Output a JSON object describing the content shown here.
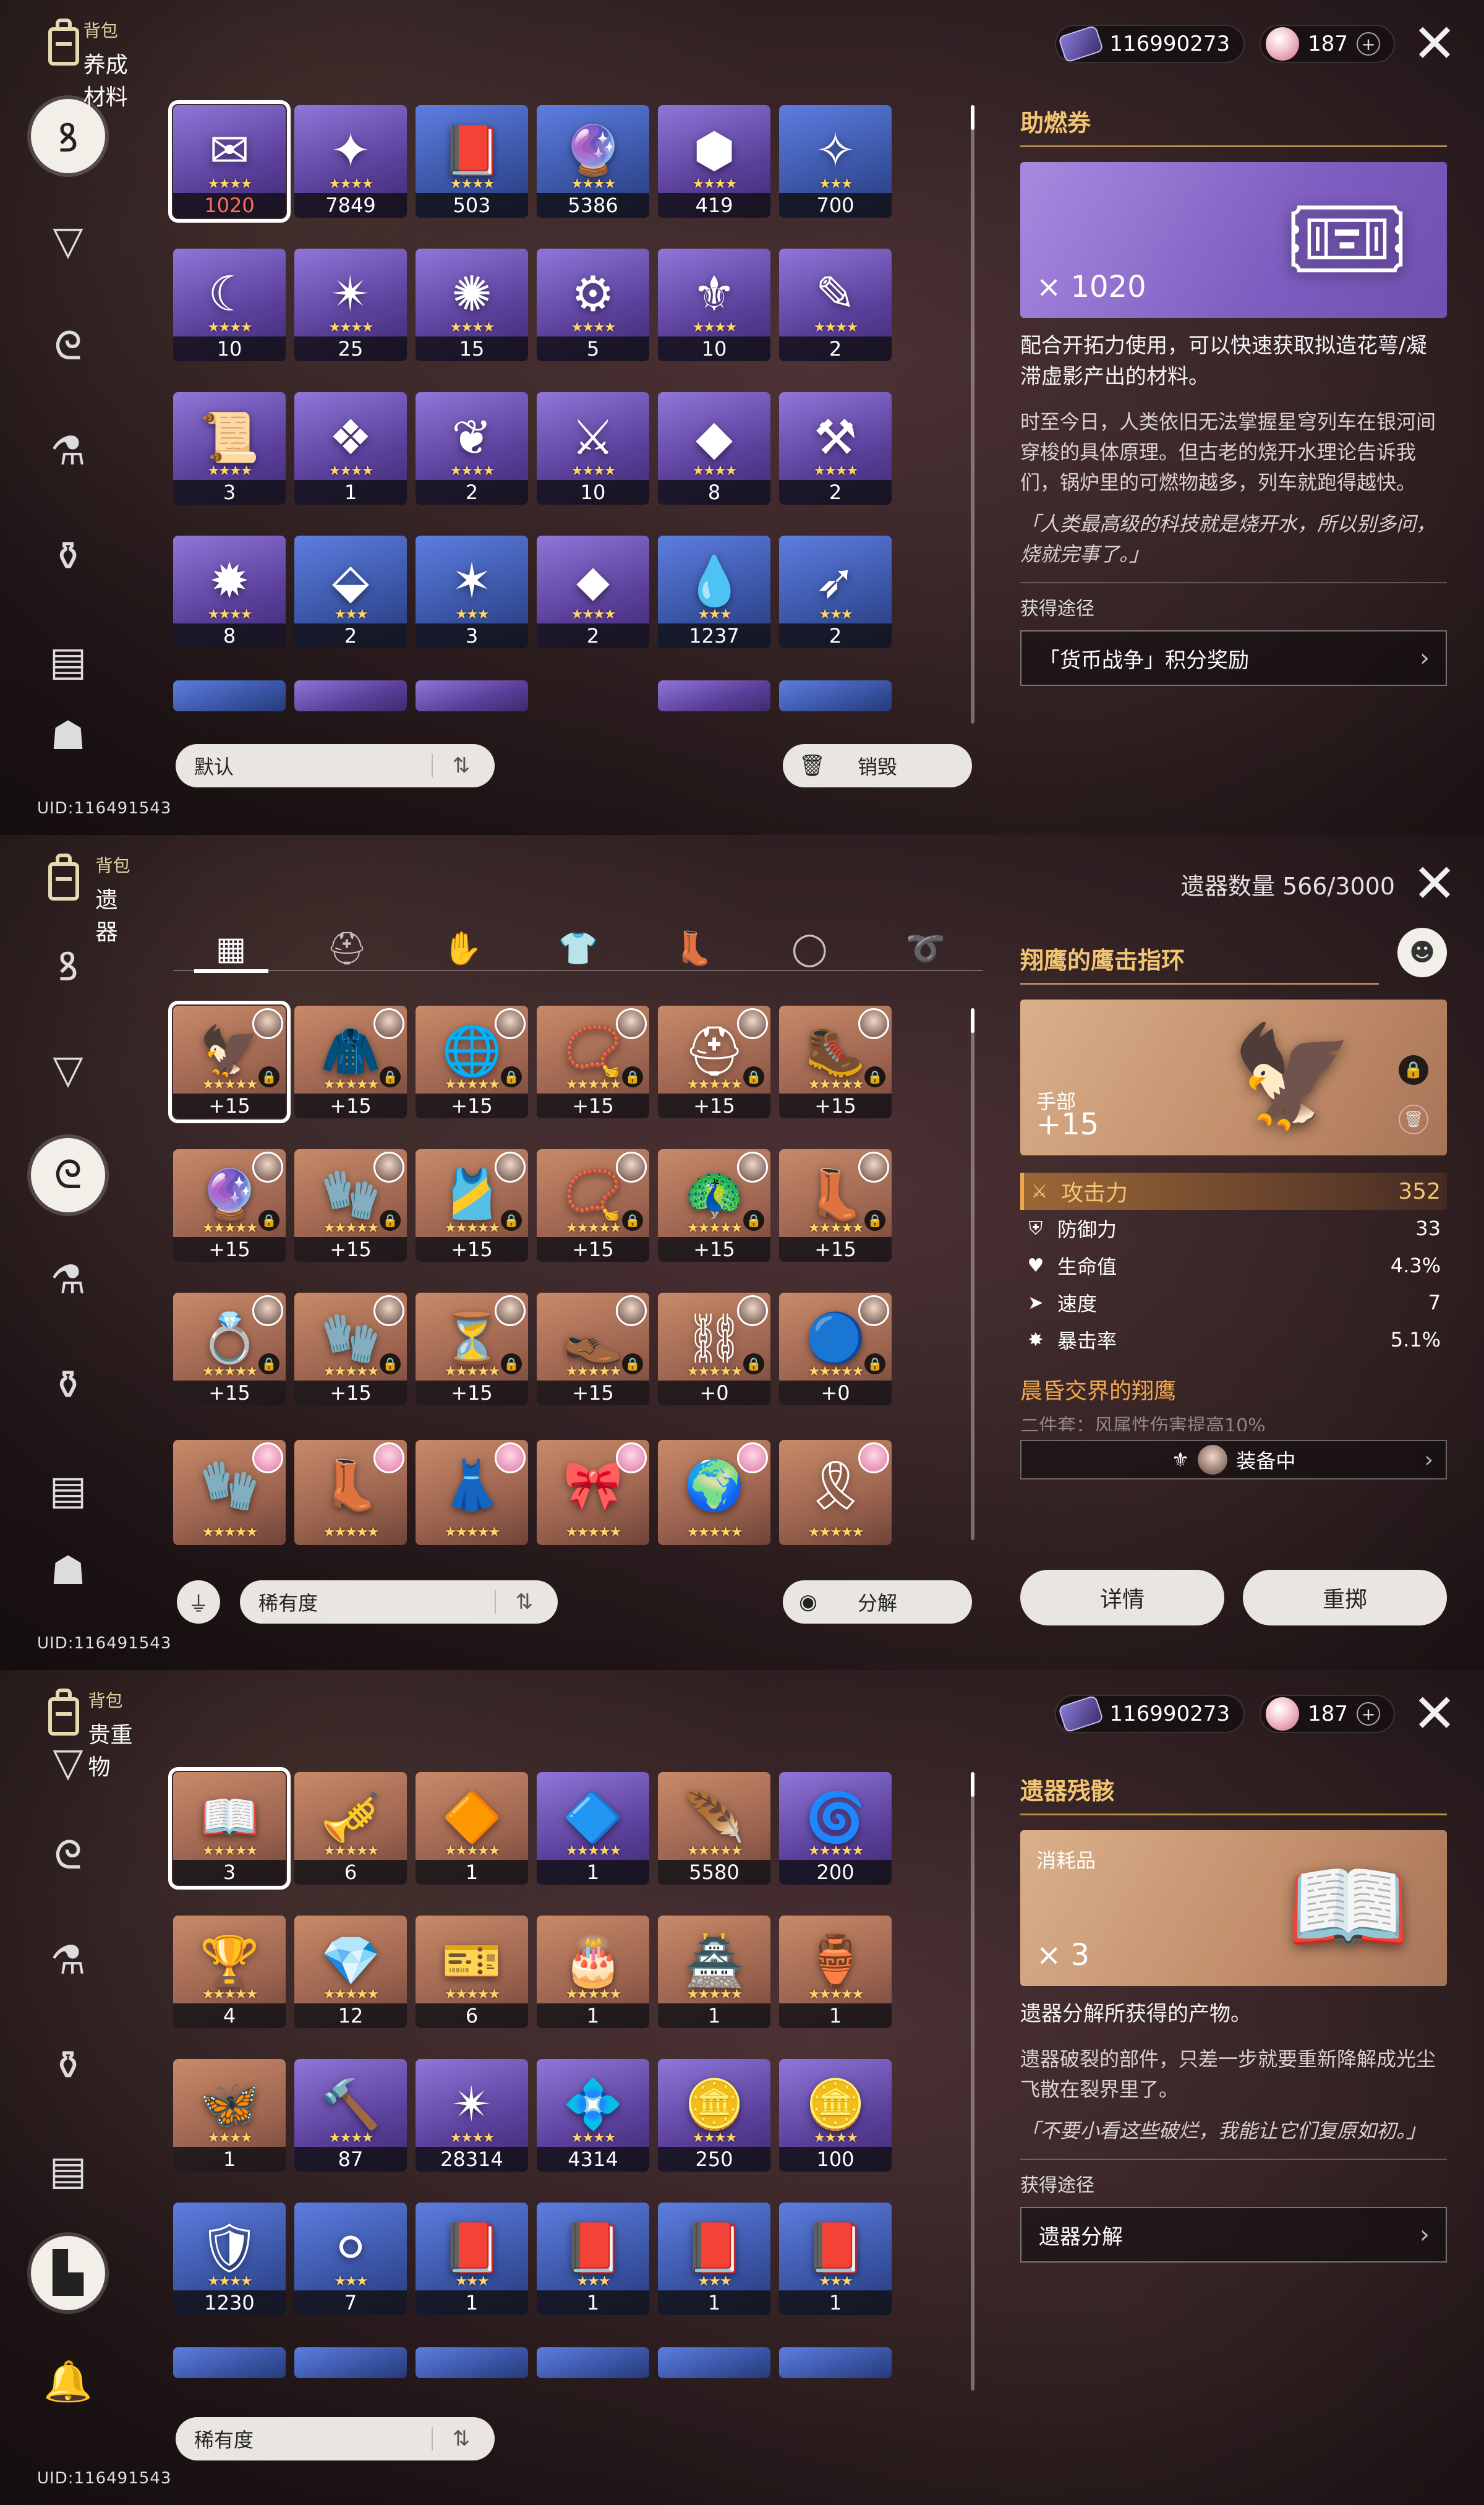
{
  "uid": "UID:116491543",
  "currency": {
    "credits": "116990273",
    "jades": "187",
    "plus": "+"
  },
  "panel1": {
    "section_small": "背包",
    "section_big": "养成材料",
    "items": [
      {
        "qty": "1020",
        "stars": "★★★★",
        "tone": "purple",
        "icon": "✉",
        "red": true
      },
      {
        "qty": "7849",
        "stars": "★★★★",
        "tone": "purple",
        "icon": "✦"
      },
      {
        "qty": "503",
        "stars": "★★★★",
        "tone": "blue",
        "icon": "📕"
      },
      {
        "qty": "5386",
        "stars": "★★★★",
        "tone": "blue",
        "icon": "🔮"
      },
      {
        "qty": "419",
        "stars": "★★★★",
        "tone": "purple",
        "icon": "⬢"
      },
      {
        "qty": "700",
        "stars": "★★★",
        "tone": "blue",
        "icon": "✧"
      },
      {
        "qty": "10",
        "stars": "★★★★",
        "tone": "purple",
        "icon": "☾"
      },
      {
        "qty": "25",
        "stars": "★★★★",
        "tone": "purple",
        "icon": "✴"
      },
      {
        "qty": "15",
        "stars": "★★★★",
        "tone": "purple",
        "icon": "✺"
      },
      {
        "qty": "5",
        "stars": "★★★★",
        "tone": "purple",
        "icon": "⚙"
      },
      {
        "qty": "10",
        "stars": "★★★★",
        "tone": "purple",
        "icon": "⚜"
      },
      {
        "qty": "2",
        "stars": "★★★★",
        "tone": "purple",
        "icon": "✎"
      },
      {
        "qty": "3",
        "stars": "★★★★",
        "tone": "purple",
        "icon": "📜"
      },
      {
        "qty": "1",
        "stars": "★★★★",
        "tone": "purple",
        "icon": "❖"
      },
      {
        "qty": "2",
        "stars": "★★★★",
        "tone": "purple",
        "icon": "❦"
      },
      {
        "qty": "10",
        "stars": "★★★★",
        "tone": "purple",
        "icon": "⚔"
      },
      {
        "qty": "8",
        "stars": "★★★★",
        "tone": "purple",
        "icon": "◆"
      },
      {
        "qty": "2",
        "stars": "★★★★",
        "tone": "purple",
        "icon": "⚒"
      },
      {
        "qty": "8",
        "stars": "★★★★",
        "tone": "purple",
        "icon": "✹"
      },
      {
        "qty": "2",
        "stars": "★★★",
        "tone": "blue",
        "icon": "⬙"
      },
      {
        "qty": "3",
        "stars": "★★★",
        "tone": "blue",
        "icon": "✶"
      },
      {
        "qty": "2",
        "stars": "★★★★",
        "tone": "purple",
        "icon": "⬥"
      },
      {
        "qty": "1237",
        "stars": "★★★",
        "tone": "blue",
        "icon": "💧"
      },
      {
        "qty": "2",
        "stars": "★★★",
        "tone": "blue",
        "icon": "➶"
      }
    ],
    "sort_label": "默认",
    "destroy_label": "销毁",
    "detail": {
      "title": "助燃券",
      "count": "× 1020",
      "desc": "配合开拓力使用，可以快速获取拟造花萼/凝滞虚影产出的材料。",
      "lore": "时至今日，人类依旧无法掌握星穹列车在银河间穿梭的具体原理。但古老的烧开水理论告诉我们，锅炉里的可燃物越多，列车就跑得越快。",
      "quote": "「人类最高级的科技就是烧开水，所以别多问，烧就完事了。」",
      "source_label": "获得途径",
      "source": "「货币战争」积分奖励"
    }
  },
  "panel2": {
    "section_small": "背包",
    "section_big": "遗器",
    "count_text": "遗器数量 566/3000",
    "items": [
      {
        "qty": "+15",
        "stars": "★★★★★",
        "icon": "🦅",
        "ava": "m"
      },
      {
        "qty": "+15",
        "stars": "★★★★★",
        "icon": "🧥",
        "ava": "m"
      },
      {
        "qty": "+15",
        "stars": "★★★★★",
        "icon": "🌐",
        "ava": "m"
      },
      {
        "qty": "+15",
        "stars": "★★★★★",
        "icon": "📿",
        "ava": "m"
      },
      {
        "qty": "+15",
        "stars": "★★★★★",
        "icon": "⛑",
        "ava": "m"
      },
      {
        "qty": "+15",
        "stars": "★★★★★",
        "icon": "🥾",
        "ava": "m"
      },
      {
        "qty": "+15",
        "stars": "★★★★★",
        "icon": "🔮",
        "ava": "m"
      },
      {
        "qty": "+15",
        "stars": "★★★★★",
        "icon": "🧤",
        "ava": "m"
      },
      {
        "qty": "+15",
        "stars": "★★★★★",
        "icon": "🎽",
        "ava": "m"
      },
      {
        "qty": "+15",
        "stars": "★★★★★",
        "icon": "📿",
        "ava": "m"
      },
      {
        "qty": "+15",
        "stars": "★★★★★",
        "icon": "🦚",
        "ava": "m"
      },
      {
        "qty": "+15",
        "stars": "★★★★★",
        "icon": "👢",
        "ava": "m"
      },
      {
        "qty": "+15",
        "stars": "★★★★★",
        "icon": "💍",
        "ava": "m"
      },
      {
        "qty": "+15",
        "stars": "★★★★★",
        "icon": "🧤",
        "ava": "m"
      },
      {
        "qty": "+15",
        "stars": "★★★★★",
        "icon": "⏳",
        "ava": "m"
      },
      {
        "qty": "+15",
        "stars": "★★★★★",
        "icon": "👞",
        "ava": "m"
      },
      {
        "qty": "+0",
        "stars": "★★★★★",
        "icon": "⛓",
        "ava": "m"
      },
      {
        "qty": "+0",
        "stars": "★★★★★",
        "icon": "🔵",
        "ava": "m"
      }
    ],
    "row4": [
      "🧤",
      "👢",
      "👗",
      "🎀",
      "🌍",
      "🎗"
    ],
    "filter_icon": "filter-icon",
    "sort_label": "稀有度",
    "dismantle_label": "分解",
    "detail": {
      "title": "翔鹰的鹰击指环",
      "slot": "手部",
      "level": "+15",
      "main_stat": {
        "name": "攻击力",
        "value": "352"
      },
      "stats": [
        {
          "icon": "⛨",
          "name": "防御力",
          "value": "33"
        },
        {
          "icon": "♥",
          "name": "生命值",
          "value": "4.3%"
        },
        {
          "icon": "➤",
          "name": "速度",
          "value": "7"
        },
        {
          "icon": "✸",
          "name": "暴击率",
          "value": "5.1%"
        }
      ],
      "set_name": "晨昏交界的翔鹰",
      "set_fade": "二件套：风属性伤害提高10%",
      "equipped": "装备中",
      "details_btn": "详情",
      "reroll_btn": "重掷"
    }
  },
  "panel3": {
    "section_small": "背包",
    "section_big": "贵重物",
    "items": [
      {
        "qty": "3",
        "stars": "★★★★★",
        "tone": "gold",
        "icon": "📖"
      },
      {
        "qty": "6",
        "stars": "★★★★★",
        "tone": "gold",
        "icon": "🎺"
      },
      {
        "qty": "1",
        "stars": "★★★★★",
        "tone": "gold",
        "icon": "🔶"
      },
      {
        "qty": "1",
        "stars": "★★★★★",
        "tone": "purple",
        "icon": "🔷"
      },
      {
        "qty": "5580",
        "stars": "★★★★★",
        "tone": "gold",
        "icon": "🪶"
      },
      {
        "qty": "200",
        "stars": "★★★★★",
        "tone": "purple",
        "icon": "🌀"
      },
      {
        "qty": "4",
        "stars": "★★★★★",
        "tone": "gold",
        "icon": "🏆"
      },
      {
        "qty": "12",
        "stars": "★★★★★",
        "tone": "gold",
        "icon": "💎"
      },
      {
        "qty": "6",
        "stars": "★★★★★",
        "tone": "gold",
        "icon": "🎫"
      },
      {
        "qty": "1",
        "stars": "★★★★★",
        "tone": "gold",
        "icon": "🎂"
      },
      {
        "qty": "1",
        "stars": "★★★★★",
        "tone": "gold",
        "icon": "🏯"
      },
      {
        "qty": "1",
        "stars": "★★★★★",
        "tone": "gold",
        "icon": "🏺"
      },
      {
        "qty": "1",
        "stars": "★★★★",
        "tone": "gold",
        "icon": "🦋"
      },
      {
        "qty": "87",
        "stars": "★★★★",
        "tone": "purple",
        "icon": "🔨"
      },
      {
        "qty": "28314",
        "stars": "★★★★",
        "tone": "purple",
        "icon": "✴"
      },
      {
        "qty": "4314",
        "stars": "★★★★",
        "tone": "purple",
        "icon": "💠"
      },
      {
        "qty": "250",
        "stars": "★★★★",
        "tone": "purple",
        "icon": "🪙"
      },
      {
        "qty": "100",
        "stars": "★★★★",
        "tone": "purple",
        "icon": "🪙"
      },
      {
        "qty": "1230",
        "stars": "★★★★",
        "tone": "blue",
        "icon": "🛡"
      },
      {
        "qty": "7",
        "stars": "★★★",
        "tone": "blue",
        "icon": "⚪"
      },
      {
        "qty": "1",
        "stars": "★★★",
        "tone": "blue",
        "icon": "📕"
      },
      {
        "qty": "1",
        "stars": "★★★",
        "tone": "blue",
        "icon": "📕"
      },
      {
        "qty": "1",
        "stars": "★★★",
        "tone": "blue",
        "icon": "📕"
      },
      {
        "qty": "1",
        "stars": "★★★",
        "tone": "blue",
        "icon": "📕"
      }
    ],
    "sort_label": "稀有度",
    "detail": {
      "title": "遗器残骸",
      "sub": "消耗品",
      "count": "× 3",
      "desc": "遗器分解所获得的产物。",
      "lore": "遗器破裂的部件，只差一步就要重新降解成光尘飞散在裂界里了。",
      "quote": "「不要小看这些破烂，我能让它们复原如初。」",
      "source_label": "获得途径",
      "source": "遗器分解"
    }
  }
}
